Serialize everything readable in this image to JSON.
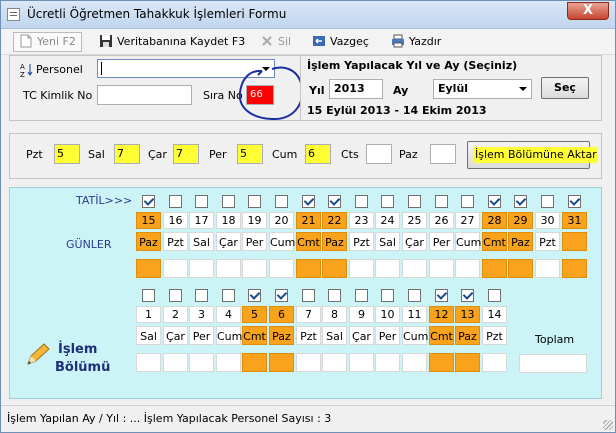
{
  "window": {
    "title": "Ücretli Öğretmen Tahakkuk İşlemleri Formu",
    "close": "X"
  },
  "toolbar": {
    "new": "Yeni  F2",
    "save": "Veritabanına Kaydet F3",
    "delete": "Sil",
    "cancel": "Vazgeç",
    "print": "Yazdır"
  },
  "form": {
    "personel_label": "Personel",
    "personel_value": "",
    "tc_label": "TC Kimlik No",
    "tc_value": "",
    "sira_label": "Sıra No",
    "sira_value": "66",
    "sort_icon": "az-sort-icon"
  },
  "period": {
    "title": "İşlem Yapılacak Yıl ve Ay (Seçiniz)",
    "year_label": "Yıl",
    "year_value": "2013",
    "month_label": "Ay",
    "month_value": "Eylül",
    "select_button": "Seç",
    "range": "15 Eylül 2013 - 14 Ekim 2013"
  },
  "weekdays": {
    "items": [
      {
        "label": "Pzt",
        "value": "5",
        "hl": true
      },
      {
        "label": "Sal",
        "value": "7",
        "hl": true
      },
      {
        "label": "Çar",
        "value": "7",
        "hl": true
      },
      {
        "label": "Per",
        "value": "5",
        "hl": true
      },
      {
        "label": "Cum",
        "value": "6",
        "hl": true
      },
      {
        "label": "Cts",
        "value": "",
        "hl": false
      },
      {
        "label": "Paz",
        "value": "",
        "hl": false
      }
    ],
    "transfer_button": "İşlem Bölümüne Aktar"
  },
  "calendar": {
    "tatil_label": "TATİL>>>",
    "gunler_label": "GÜNLER",
    "toplam_label": "Toplam",
    "islem_label_1": "İşlem",
    "islem_label_2": "Bölümü",
    "row1": [
      {
        "d": "15",
        "n": "Paz",
        "c": true,
        "o": true
      },
      {
        "d": "16",
        "n": "Pzt",
        "c": false,
        "o": false
      },
      {
        "d": "17",
        "n": "Sal",
        "c": false,
        "o": false
      },
      {
        "d": "18",
        "n": "Çar",
        "c": false,
        "o": false
      },
      {
        "d": "19",
        "n": "Per",
        "c": false,
        "o": false
      },
      {
        "d": "20",
        "n": "Cum",
        "c": false,
        "o": false
      },
      {
        "d": "21",
        "n": "Cmt",
        "c": true,
        "o": true
      },
      {
        "d": "22",
        "n": "Paz",
        "c": true,
        "o": true
      },
      {
        "d": "23",
        "n": "Pzt",
        "c": false,
        "o": false
      },
      {
        "d": "24",
        "n": "Sal",
        "c": false,
        "o": false
      },
      {
        "d": "25",
        "n": "Çar",
        "c": false,
        "o": false
      },
      {
        "d": "26",
        "n": "Per",
        "c": false,
        "o": false
      },
      {
        "d": "27",
        "n": "Cum",
        "c": false,
        "o": false
      },
      {
        "d": "28",
        "n": "Cmt",
        "c": true,
        "o": true
      },
      {
        "d": "29",
        "n": "Paz",
        "c": true,
        "o": true
      },
      {
        "d": "30",
        "n": "Pzt",
        "c": false,
        "o": false
      },
      {
        "d": "31",
        "n": "",
        "c": true,
        "o": true
      }
    ],
    "row2": [
      {
        "d": "1",
        "n": "Sal",
        "c": false,
        "o": false
      },
      {
        "d": "2",
        "n": "Çar",
        "c": false,
        "o": false
      },
      {
        "d": "3",
        "n": "Per",
        "c": false,
        "o": false
      },
      {
        "d": "4",
        "n": "Cum",
        "c": false,
        "o": false
      },
      {
        "d": "5",
        "n": "Cmt",
        "c": true,
        "o": true
      },
      {
        "d": "6",
        "n": "Paz",
        "c": true,
        "o": true
      },
      {
        "d": "7",
        "n": "Pzt",
        "c": false,
        "o": false
      },
      {
        "d": "8",
        "n": "Sal",
        "c": false,
        "o": false
      },
      {
        "d": "9",
        "n": "Çar",
        "c": false,
        "o": false
      },
      {
        "d": "10",
        "n": "Per",
        "c": false,
        "o": false
      },
      {
        "d": "11",
        "n": "Cum",
        "c": false,
        "o": false
      },
      {
        "d": "12",
        "n": "Cmt",
        "c": true,
        "o": true
      },
      {
        "d": "13",
        "n": "Paz",
        "c": true,
        "o": true
      },
      {
        "d": "14",
        "n": "Pzt",
        "c": false,
        "o": false
      }
    ]
  },
  "status": {
    "text": "İşlem Yapılan Ay / Yıl :  ...  İşlem Yapılacak Personel Sayısı :  3"
  },
  "colors": {
    "holiday": "#f9a21b",
    "calendar_bg": "#ccf4f7",
    "highlight": "#ffff33",
    "sira_bg": "#ff0000",
    "annotation": "#1a2e9e"
  }
}
